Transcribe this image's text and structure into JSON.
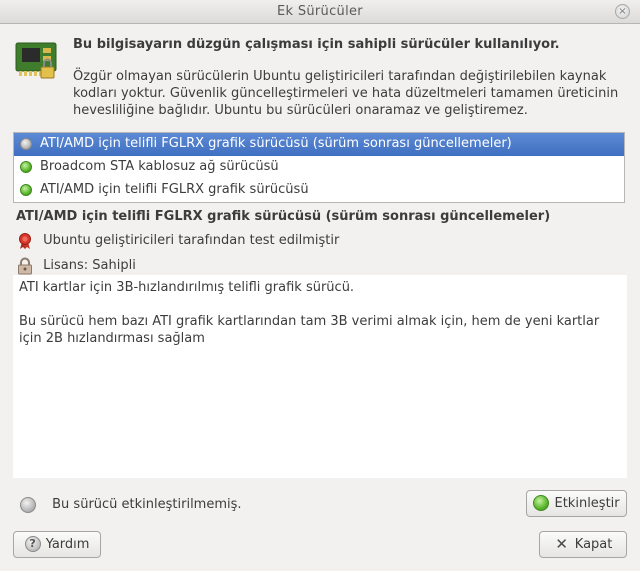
{
  "window": {
    "title": "Ek Sürücüler",
    "close_glyph": "×"
  },
  "header": {
    "icon": "hardware-chip-icon",
    "heading": "Bu bilgisayarın düzgün çalışması için sahipli sürücüler kullanılıyor.",
    "description": "Özgür olmayan sürücülerin Ubuntu geliştiricileri tarafından değiştirilebilen kaynak kodları yoktur. Güvenlik güncelleştirmeleri ve hata düzeltmeleri tamamen üreticinin hevesliliğine bağlıdır. Ubuntu bu sürücüleri onaramaz ve geliştiremez."
  },
  "drivers": [
    {
      "label": "ATI/AMD için telifli FGLRX grafik sürücüsü (sürüm sonrası güncellemeler)",
      "status": "disabled",
      "selected": true
    },
    {
      "label": "Broadcom STA kablosuz ağ sürücüsü",
      "status": "enabled",
      "selected": false
    },
    {
      "label": "ATI/AMD için telifli FGLRX grafik sürücüsü",
      "status": "enabled",
      "selected": false
    }
  ],
  "detail": {
    "title": "ATI/AMD için telifli FGLRX grafik sürücüsü (sürüm sonrası güncellemeler)",
    "tested": "Ubuntu geliştiricileri tarafından test edilmiştir",
    "license": "Lisans: Sahipli",
    "description_lines": [
      "ATI kartlar için 3B-hızlandırılmış telifli grafik sürücü.",
      "Bu sürücü hem bazı ATI grafik kartlarından tam 3B verimi almak için, hem de yeni kartlar için 2B hızlandırması sağlam"
    ]
  },
  "status": {
    "text": "Bu sürücü etkinleştirilmemiş.",
    "state": "disabled"
  },
  "buttons": {
    "activate": "Etkinleştir",
    "help": "Yardım",
    "close": "Kapat"
  },
  "colors": {
    "selection": "#4a7bcb",
    "enabled": "#59b52c",
    "disabled": "#b9b9b9"
  }
}
